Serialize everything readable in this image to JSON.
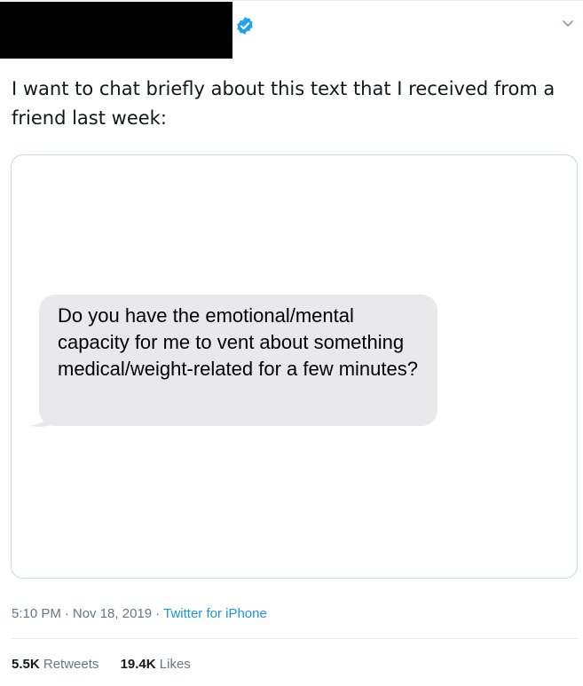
{
  "tweet": {
    "text": "I want to chat briefly about this text that I received from a friend last week:",
    "author_badge_icon": "verified-badge-icon",
    "menu_icon": "chevron-down-icon"
  },
  "media": {
    "message_text": "Do you have the emotional/mental capacity for me to vent about something medical/weight-related for a few minutes?",
    "bubble_color": "#e9e9eb"
  },
  "meta": {
    "time": "5:10 PM",
    "separator": "·",
    "date": "Nov 18, 2019",
    "source": "Twitter for iPhone"
  },
  "stats": {
    "retweets_count": "5.5K",
    "retweets_label": "Retweets",
    "likes_count": "19.4K",
    "likes_label": "Likes"
  },
  "colors": {
    "accent": "#1b95e0",
    "verified": "#1da1f2",
    "secondary_text": "#657786",
    "border": "#ccd6dd"
  }
}
